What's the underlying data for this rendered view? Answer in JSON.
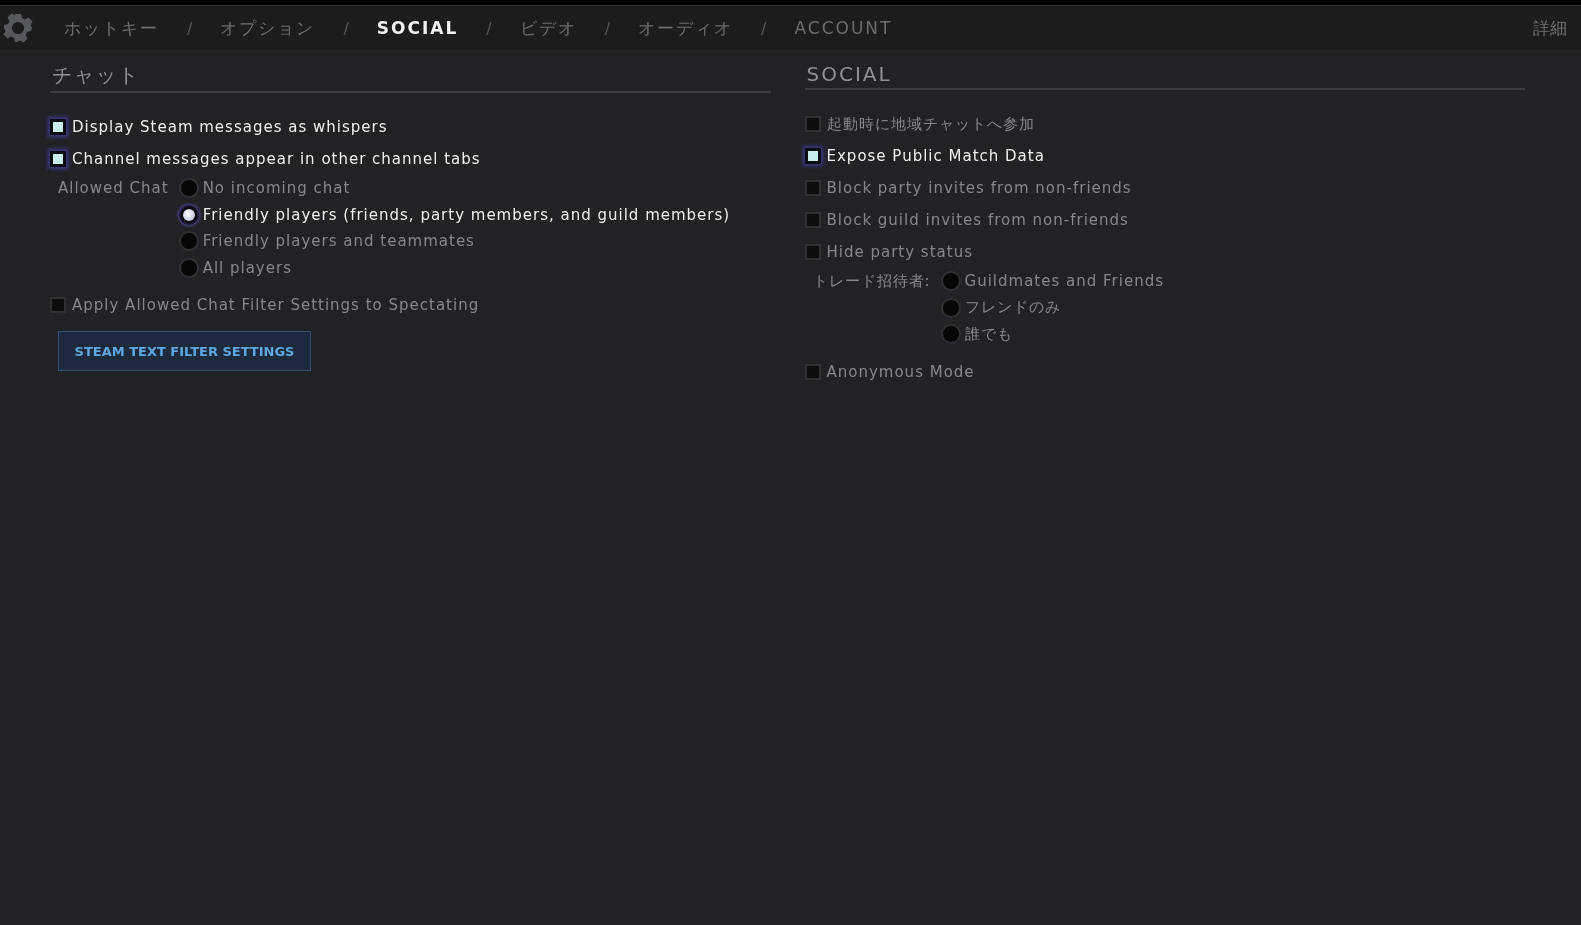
{
  "nav": {
    "items": [
      {
        "kind": "tab",
        "label": "ホットキー",
        "selected": false
      },
      {
        "kind": "separator",
        "label": "/"
      },
      {
        "kind": "tab",
        "label": "オプション",
        "selected": false
      },
      {
        "kind": "separator",
        "label": "/"
      },
      {
        "kind": "tab",
        "label": "SOCIAL",
        "selected": true
      },
      {
        "kind": "separator",
        "label": "/"
      },
      {
        "kind": "tab",
        "label": "ビデオ",
        "selected": false
      },
      {
        "kind": "separator",
        "label": "/"
      },
      {
        "kind": "tab",
        "label": "オーディオ",
        "selected": false
      },
      {
        "kind": "separator",
        "label": "/"
      },
      {
        "kind": "tab",
        "label": "ACCOUNT",
        "selected": false
      }
    ],
    "details": "詳細"
  },
  "sections": [
    {
      "title": "チャット",
      "items": [
        {
          "kind": "checkbox",
          "label": "Display Steam messages as whispers",
          "checked": true
        },
        {
          "kind": "checkbox",
          "label": "Channel messages appear in other channel tabs",
          "checked": true
        },
        {
          "kind": "radio_group",
          "label": "Allowed Chat",
          "options": [
            {
              "label": "No incoming chat",
              "selected": false
            },
            {
              "label": "Friendly players (friends, party members, and guild members)",
              "selected": true
            },
            {
              "label": "Friendly players and teammates",
              "selected": false
            },
            {
              "label": "All players",
              "selected": false
            }
          ]
        },
        {
          "kind": "checkbox",
          "label": "Apply Allowed Chat Filter Settings to Spectating",
          "checked": false
        },
        {
          "kind": "button",
          "label": "STEAM TEXT FILTER SETTINGS"
        }
      ]
    },
    {
      "title": "SOCIAL",
      "items": [
        {
          "kind": "checkbox",
          "label": "起動時に地域チャットへ参加",
          "checked": false
        },
        {
          "kind": "checkbox",
          "label": "Expose Public Match Data",
          "checked": true
        },
        {
          "kind": "checkbox",
          "label": "Block party invites from non-friends",
          "checked": false
        },
        {
          "kind": "checkbox",
          "label": "Block guild invites from non-friends",
          "checked": false
        },
        {
          "kind": "checkbox",
          "label": "Hide party status",
          "checked": false
        },
        {
          "kind": "radio_group",
          "label": "トレード招待者:",
          "options": [
            {
              "label": "Guildmates and Friends",
              "selected": false
            },
            {
              "label": "フレンドのみ",
              "selected": false
            },
            {
              "label": "誰でも",
              "selected": false
            }
          ]
        },
        {
          "kind": "checkbox",
          "label": "Anonymous Mode",
          "checked": false
        }
      ]
    }
  ]
}
